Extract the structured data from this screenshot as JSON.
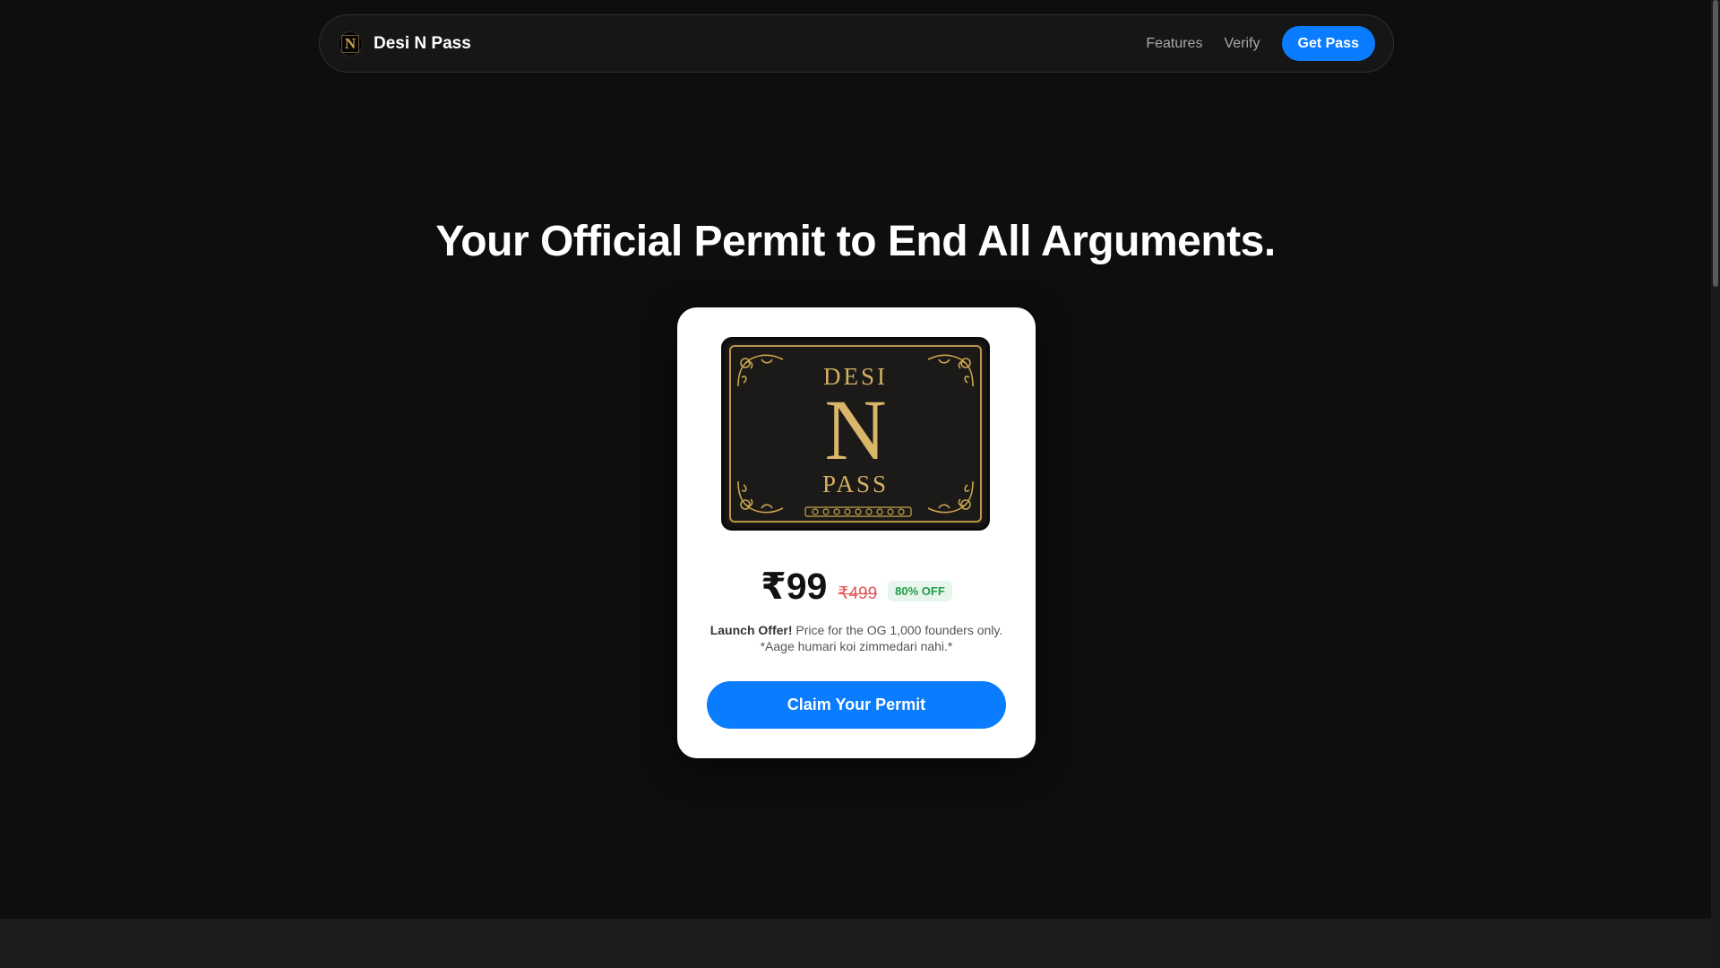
{
  "nav": {
    "brand_logo_letter": "N",
    "brand_name": "Desi N Pass",
    "links": [
      "Features",
      "Verify"
    ],
    "cta_label": "Get Pass"
  },
  "hero": {
    "title": "Your Official Permit to End All Arguments."
  },
  "pass_card": {
    "image": {
      "line1": "DESI",
      "big_letter": "N",
      "line2": "PASS"
    },
    "price_now": "₹99",
    "price_old": "₹499",
    "discount": "80% OFF",
    "offer_bold": "Launch Offer!",
    "offer_text": " Price for the OG 1,000 founders only. *Aage humari koi zimmedari nahi.*",
    "claim_label": "Claim Your Permit"
  },
  "colors": {
    "accent": "#0a7cff",
    "background": "#0e0e0e",
    "gold": "#d4b064",
    "discount_green": "#1f9d4b",
    "old_price_red": "#e05555"
  }
}
